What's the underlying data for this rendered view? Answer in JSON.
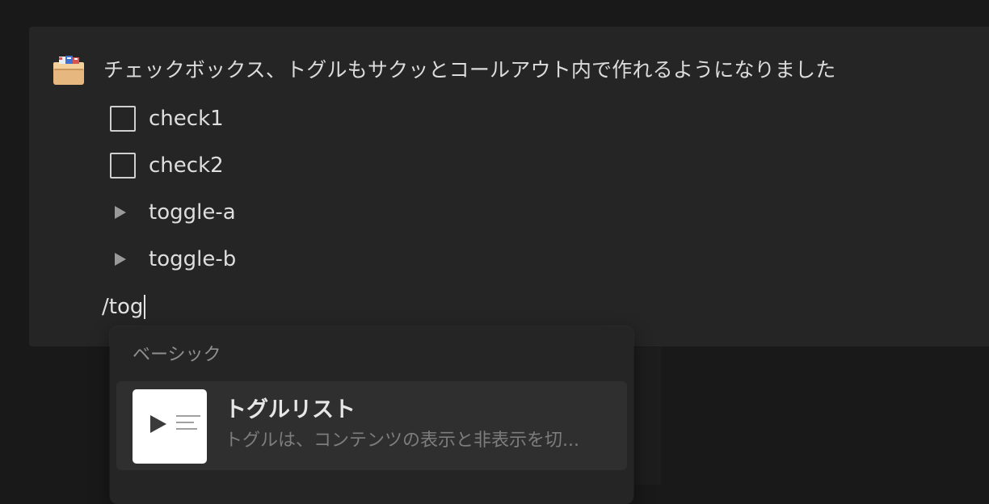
{
  "callout": {
    "icon": "card-file-box-icon",
    "title": "チェックボックス、トグルもサクッとコールアウト内で作れるようになりました",
    "items": [
      {
        "type": "checkbox",
        "label": "check1",
        "checked": false
      },
      {
        "type": "checkbox",
        "label": "check2",
        "checked": false
      },
      {
        "type": "toggle",
        "label": "toggle-a"
      },
      {
        "type": "toggle",
        "label": "toggle-b"
      }
    ],
    "input_value": "/tog"
  },
  "slash_menu": {
    "section_label": "ベーシック",
    "items": [
      {
        "icon": "toggle-list-icon",
        "title": "トグルリスト",
        "description": "トグルは、コンテンツの表示と非表示を切..."
      }
    ]
  },
  "colors": {
    "background": "#191919",
    "callout_bg": "#252525",
    "menu_item_highlight": "#2f2f2f"
  }
}
